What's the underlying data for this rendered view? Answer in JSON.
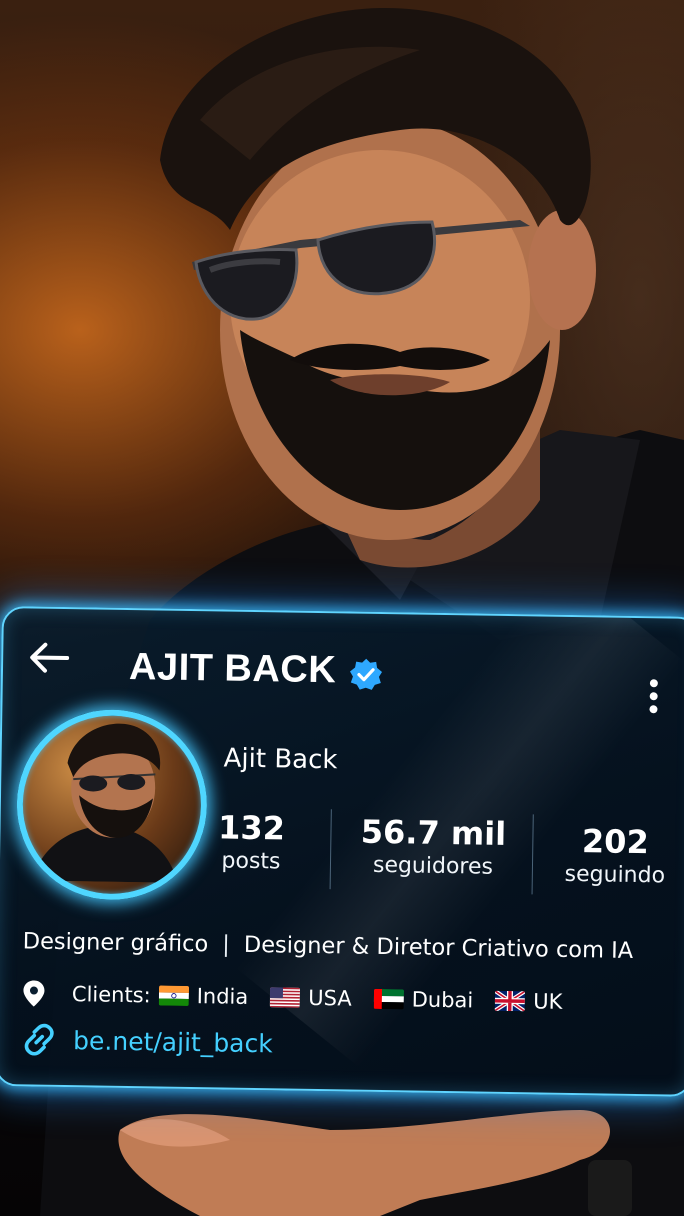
{
  "header": {
    "title": "AJIT BACK",
    "back_icon": "arrow-left-icon",
    "verified_icon": "verified-badge-icon",
    "more_icon": "more-vertical-icon"
  },
  "profile": {
    "display_name": "Ajit Back",
    "stats": [
      {
        "value": "132",
        "label": "posts"
      },
      {
        "value": "56.7 mil",
        "label": "seguidores"
      },
      {
        "value": "202",
        "label": "seguindo"
      }
    ],
    "bio_left": "Designer gráfico",
    "bio_separator": "|",
    "bio_right": "Designer & Diretor Criativo com IA",
    "clients_label": "Clients:",
    "clients": [
      {
        "name": "India",
        "flag": "india-flag-icon"
      },
      {
        "name": "USA",
        "flag": "usa-flag-icon"
      },
      {
        "name": "Dubai",
        "flag": "uae-flag-icon"
      },
      {
        "name": "UK",
        "flag": "uk-flag-icon"
      }
    ],
    "link": "be.net/ajit_back",
    "location_icon": "location-pin-icon",
    "link_icon": "link-icon"
  },
  "colors": {
    "accent": "#44d0ff",
    "verified": "#2ea8ff",
    "card_bg": "#061a2c"
  }
}
